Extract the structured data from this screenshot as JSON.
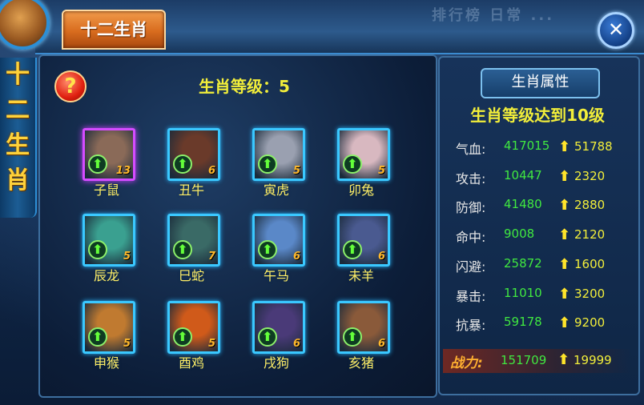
{
  "window": {
    "tab_title": "十二生肖",
    "side_title": [
      "十",
      "二",
      "生",
      "肖"
    ],
    "faded_header": "排行榜 日常 ...",
    "close_glyph": "✕",
    "help_glyph": "?"
  },
  "zodiac_panel": {
    "level_text": "生肖等级：5",
    "grid": [
      {
        "name": "子鼠",
        "level": "13",
        "selected": true,
        "color": "#8a6a58"
      },
      {
        "name": "丑牛",
        "level": "6",
        "selected": false,
        "color": "#6a3a2a"
      },
      {
        "name": "寅虎",
        "level": "5",
        "selected": false,
        "color": "#9aa0b0"
      },
      {
        "name": "卯兔",
        "level": "5",
        "selected": false,
        "color": "#d8b8c0"
      },
      {
        "name": "辰龙",
        "level": "5",
        "selected": false,
        "color": "#3aa090"
      },
      {
        "name": "巳蛇",
        "level": "7",
        "selected": false,
        "color": "#3a6a66"
      },
      {
        "name": "午马",
        "level": "6",
        "selected": false,
        "color": "#5a88c8"
      },
      {
        "name": "未羊",
        "level": "6",
        "selected": false,
        "color": "#4a5a90"
      },
      {
        "name": "申猴",
        "level": "5",
        "selected": false,
        "color": "#c07a30"
      },
      {
        "name": "酉鸡",
        "level": "5",
        "selected": false,
        "color": "#d05a1a"
      },
      {
        "name": "戌狗",
        "level": "6",
        "selected": false,
        "color": "#4a3a78"
      },
      {
        "name": "亥猪",
        "level": "6",
        "selected": false,
        "color": "#8a5a3a"
      }
    ]
  },
  "attributes_panel": {
    "title": "生肖属性",
    "subtitle": "生肖等级达到10级",
    "arrow_glyph": "⬆",
    "stats": [
      {
        "label": "气血:",
        "value": "417015",
        "bonus": "51788"
      },
      {
        "label": "攻击:",
        "value": "10447",
        "bonus": "2320"
      },
      {
        "label": "防御:",
        "value": "41480",
        "bonus": "2880"
      },
      {
        "label": "命中:",
        "value": "9008",
        "bonus": "2120"
      },
      {
        "label": "闪避:",
        "value": "25872",
        "bonus": "1600"
      },
      {
        "label": "暴击:",
        "value": "11010",
        "bonus": "3200"
      },
      {
        "label": "抗暴:",
        "value": "59178",
        "bonus": "9200"
      }
    ],
    "power": {
      "label": "战力:",
      "value": "151709",
      "bonus": "19999"
    }
  }
}
